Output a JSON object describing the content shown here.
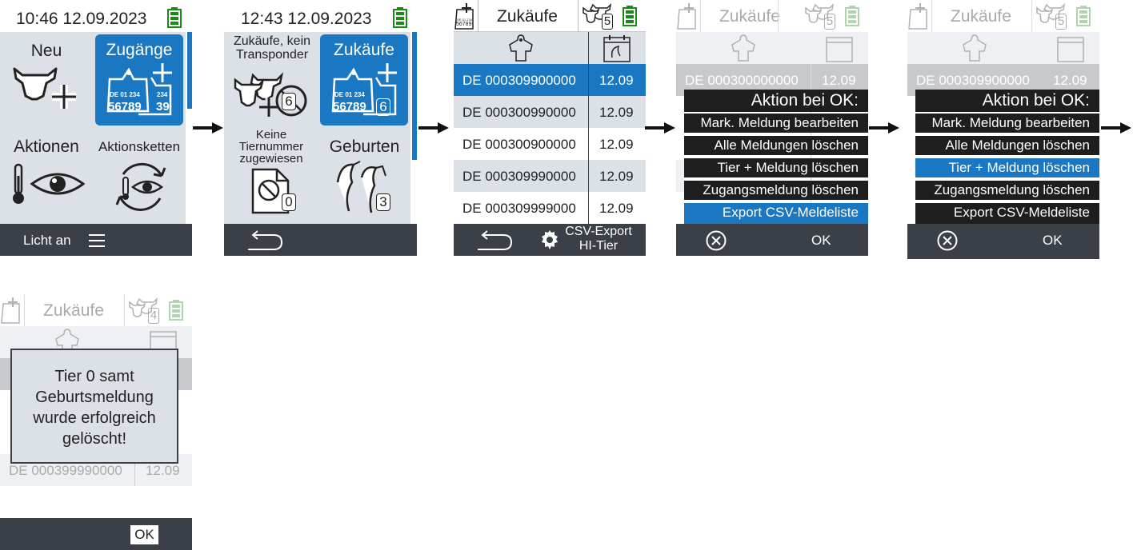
{
  "screen1": {
    "time": "10:46 12.09.2023",
    "tiles": {
      "new": "Neu",
      "arrivals": "Zugänge",
      "actions": "Aktionen",
      "action_chain": "Aktionsketten"
    },
    "tag": {
      "line1": "DE 01 234",
      "line2": "56789",
      "line2b": "789",
      "suffix1": "234",
      "suffix2": "39"
    },
    "bottom": {
      "light": "Licht an"
    }
  },
  "screen2": {
    "time": "12:43 12.09.2023",
    "tiles": {
      "purchases_no_transponder": "Zukäufe, kein Transponder",
      "purchases": "Zukäufe",
      "no_number": "Keine Tiernummer zugewiesen",
      "births": "Geburten"
    },
    "badges": {
      "no_transponder": "6",
      "purchases": "6",
      "no_number": "0",
      "births": "3"
    },
    "tag": {
      "line1": "DE 01 234",
      "line2": "56789"
    }
  },
  "screen3": {
    "title": "Zukäufe",
    "cow_count": "5",
    "rows": [
      {
        "id": "DE 000309900000",
        "date": "12.09"
      },
      {
        "id": "DE 000300990000",
        "date": "12.09"
      },
      {
        "id": "DE 000300900000",
        "date": "12.09"
      },
      {
        "id": "DE 000309990000",
        "date": "12.09"
      },
      {
        "id": "DE 000309999000",
        "date": "12.09"
      }
    ],
    "bottom": {
      "csv_line1": "CSV-Export",
      "csv_line2": "HI-Tier"
    },
    "tag_mini": {
      "line1": "DE 01 234",
      "line2": "56789"
    }
  },
  "screen4": {
    "title": "Zukäufe",
    "cow_count": "5",
    "row_id": "DE 000300000000",
    "row_date": "12.09",
    "menu_title": "Aktion bei OK:",
    "menu": [
      "Mark. Meldung bearbeiten",
      "Alle Meldungen löschen",
      "Tier + Meldung löschen",
      "Zugangsmeldung löschen",
      "Export CSV-Meldeliste"
    ],
    "ok": "OK"
  },
  "screen5": {
    "title": "Zukäufe",
    "cow_count": "5",
    "row_id": "DE 000309900000",
    "row_date": "12.09",
    "menu_title": "Aktion bei OK:",
    "menu": [
      "Mark. Meldung bearbeiten",
      "Alle Meldungen löschen",
      "Tier + Meldung löschen",
      "Zugangsmeldung löschen",
      "Export CSV-Meldeliste"
    ],
    "ok": "OK"
  },
  "screen6": {
    "title": "Zukäufe",
    "cow_count": "4",
    "row_id": "DE 000399990000",
    "row_date": "12.09",
    "message": "Tier 0 samt Geburtsmeldung wurde erfolgreich gelöscht!",
    "ok": "OK"
  },
  "colors": {
    "accent": "#1a77c2",
    "tile": "#dce1e7",
    "bar": "#3b4048",
    "battery": "#1a8a1a"
  }
}
